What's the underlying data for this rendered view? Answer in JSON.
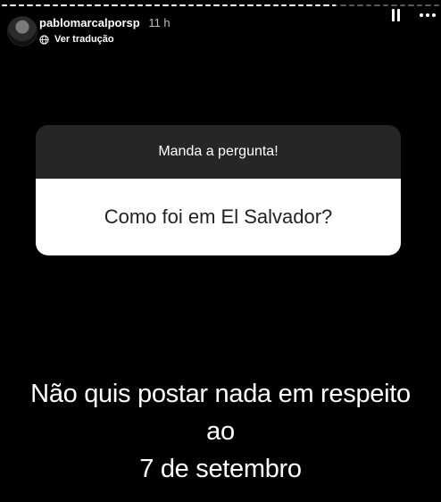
{
  "story": {
    "progress_segments": [
      1,
      1,
      1,
      1,
      1,
      1,
      1,
      1,
      1,
      1,
      1,
      1,
      1,
      1,
      1,
      1,
      1,
      1,
      1,
      1,
      1,
      1,
      1,
      1,
      1,
      1,
      1,
      1,
      1,
      1,
      1,
      1,
      1,
      1,
      1,
      1,
      1,
      1,
      1,
      0.6,
      0,
      0,
      0,
      0,
      0,
      0,
      0,
      0,
      0,
      0,
      0,
      0
    ]
  },
  "header": {
    "username": "pablomarcalporsp",
    "time": "11 h",
    "translate_label": "Ver tradução"
  },
  "question_box": {
    "prompt": "Manda a pergunta!",
    "question": "Como foi em El Salvador?"
  },
  "answer": {
    "line1": "Não quis postar nada em respeito ao",
    "line2": "7 de setembro"
  },
  "colors": {
    "background": "#000000",
    "prompt_bg": "#262626",
    "question_bg": "#ffffff"
  }
}
